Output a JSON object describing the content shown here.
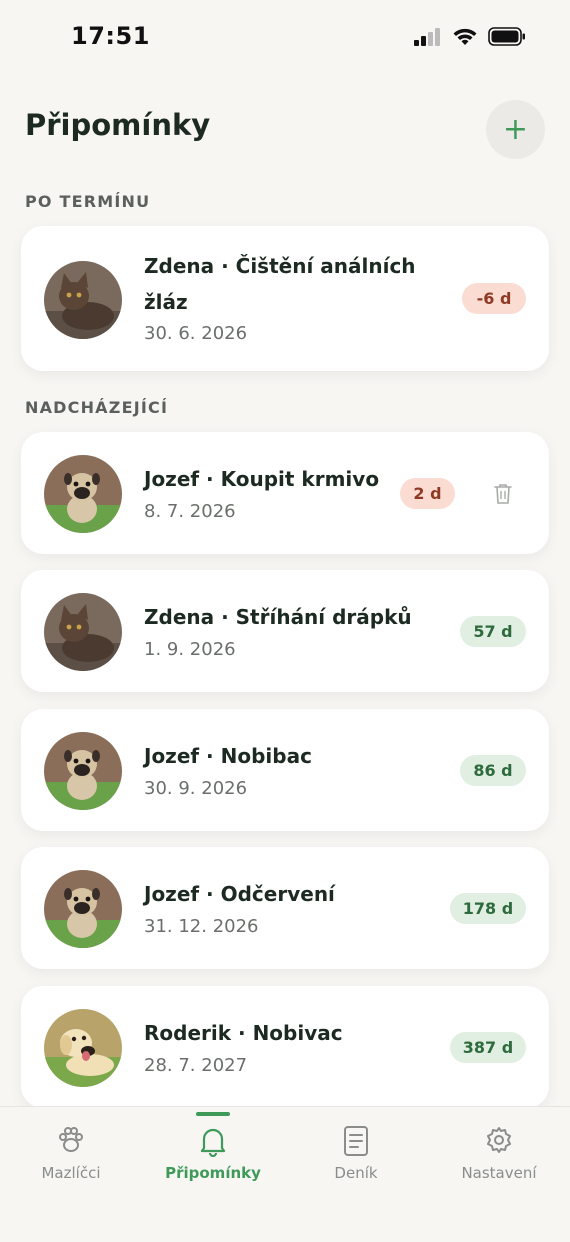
{
  "status_bar": {
    "time": "17:51"
  },
  "header": {
    "title": "Připomínky",
    "add_label": "+"
  },
  "sections": {
    "overdue": "PO TERMÍNU",
    "upcoming": "NADCHÁZEJÍCÍ"
  },
  "reminders": [
    {
      "title": "Zdena · Čištění análních žláz",
      "date": "30. 6. 2026",
      "badge": "-6 d",
      "status": "overdue",
      "pet": "cat"
    },
    {
      "title": "Jozef · Koupit krmivo",
      "date": "8. 7. 2026",
      "badge": "2 d",
      "status": "overdue",
      "pet": "pug"
    },
    {
      "title": "Zdena · Stříhání drápků",
      "date": "1. 9. 2026",
      "badge": "57 d",
      "status": "ok",
      "pet": "cat"
    },
    {
      "title": "Jozef · Nobibac",
      "date": "30. 9. 2026",
      "badge": "86 d",
      "status": "ok",
      "pet": "pug"
    },
    {
      "title": "Jozef · Odčervení",
      "date": "31. 12. 2026",
      "badge": "178 d",
      "status": "ok",
      "pet": "pug"
    },
    {
      "title": "Roderik · Nobivac",
      "date": "28. 7. 2027",
      "badge": "387 d",
      "status": "ok",
      "pet": "labrador"
    }
  ],
  "nav": [
    {
      "label": "Mazlíčci",
      "icon": "paw-icon"
    },
    {
      "label": "Připomínky",
      "icon": "bell-icon",
      "active": true
    },
    {
      "label": "Deník",
      "icon": "journal-icon"
    },
    {
      "label": "Nastavení",
      "icon": "gear-icon"
    }
  ],
  "colors": {
    "accent": "#3f9a5a",
    "overdue_bg": "#fadcd2",
    "overdue_text": "#8e3a25",
    "ok_bg": "#e1efe3",
    "ok_text": "#2e6b3c",
    "background": "#f7f6f3"
  }
}
